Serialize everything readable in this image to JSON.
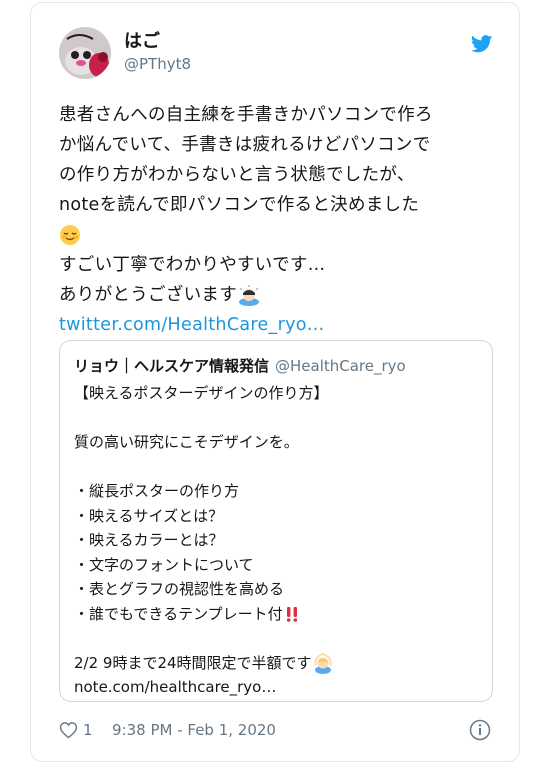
{
  "tweet": {
    "author_name": "はご",
    "author_handle": "@PThyt8",
    "lines": [
      "患者さんへの自主練を手書きかパソコンで作ろ",
      "か悩んでいて、手書きは疲れるけどパソコンで",
      "の作り方がわからないと言う状態でしたが、",
      "noteを読んで即パソコンで作ると決めました",
      "",
      "すごい丁寧でわかりやすいです…",
      "ありがとうございます"
    ],
    "link": "twitter.com/HealthCare_ryo…"
  },
  "quote": {
    "author_name": "リョウ｜ヘルスケア情報発信",
    "author_handle": "@HealthCare_ryo",
    "lines": [
      "【映えるポスターデザインの作り方】",
      "",
      "質の高い研究にこそデザインを。",
      "",
      "・縦長ポスターの作り方",
      "・映えるサイズとは？",
      "・映えるカラーとは？",
      "・文字のフォントについて",
      "・表とグラフの視認性を高める",
      "・誰でもできるテンプレート付",
      "",
      "2/2  9時まで24時間限定で半額です",
      "note.com/healthcare_ryo…"
    ]
  },
  "footer": {
    "likes": "1",
    "timestamp": "9:38 PM - Feb 1, 2020"
  },
  "icons": {
    "bird": "twitter-bird-icon",
    "heart": "heart-icon",
    "info": "info-icon"
  },
  "colors": {
    "link": "#1b95e0",
    "twitter_blue": "#1da1f2",
    "border": "#e1e8ed",
    "secondary_text": "#657786"
  }
}
